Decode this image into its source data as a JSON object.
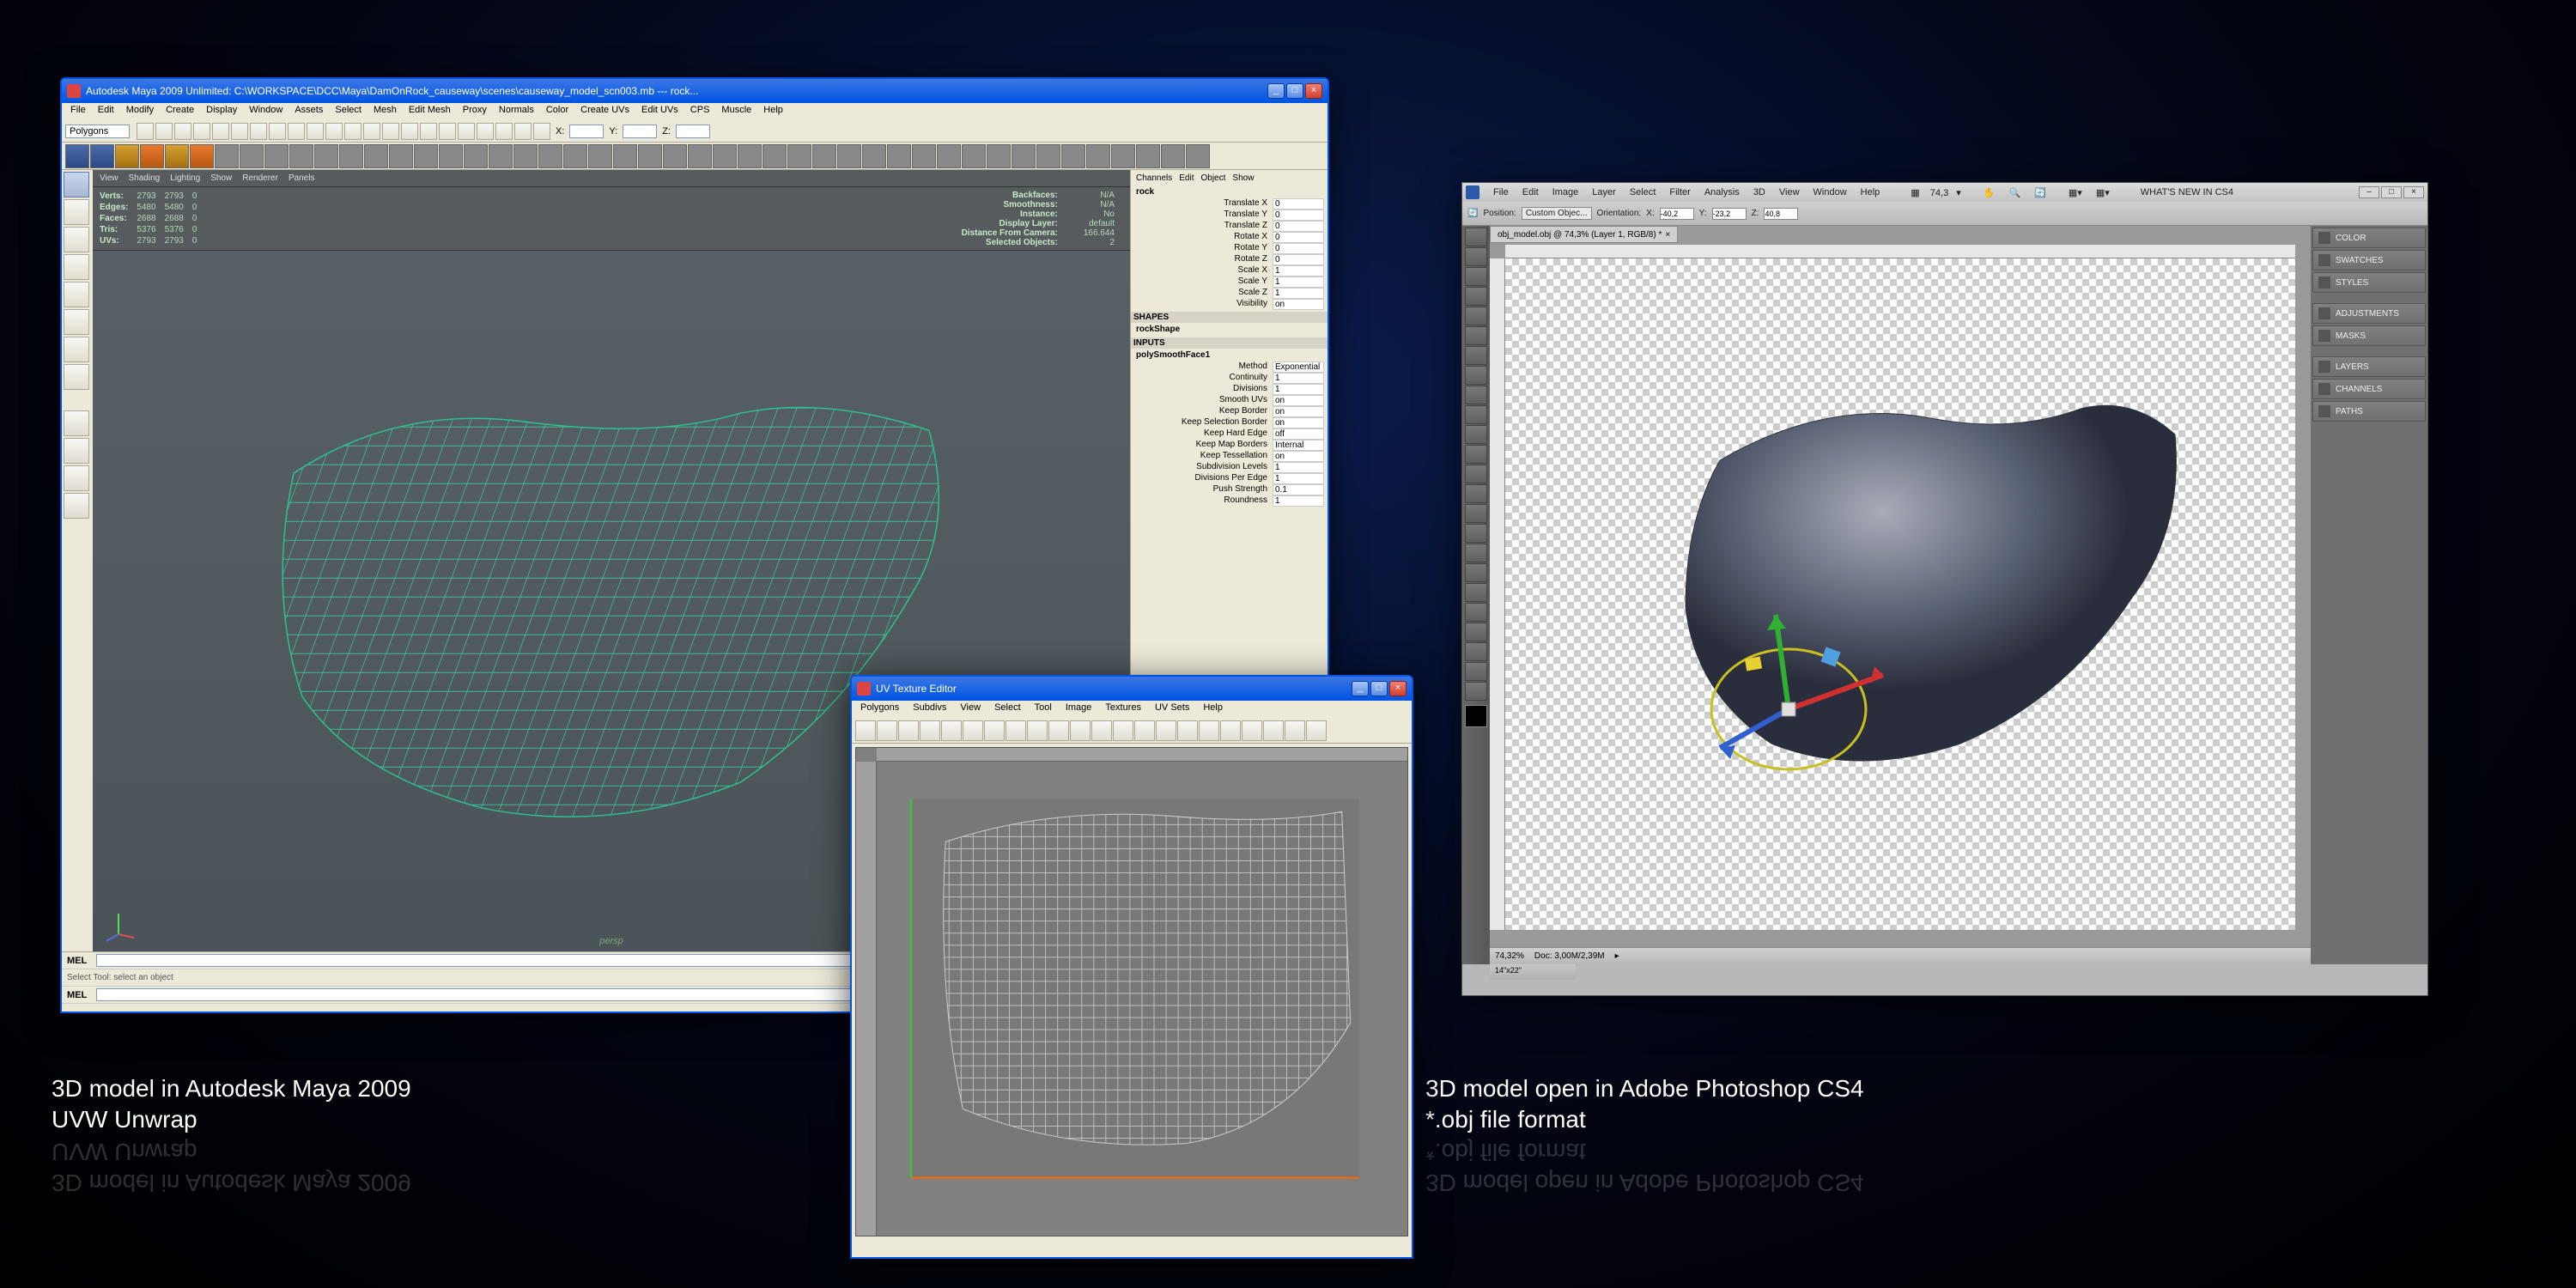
{
  "captions": {
    "left_l1": "3D model in Autodesk Maya 2009",
    "left_l2": "UVW Unwrap",
    "right_l1": "3D model open in Adobe Photoshop CS4",
    "right_l2": "*.obj file format"
  },
  "maya": {
    "title": "Autodesk Maya 2009 Unlimited: C:\\WORKSPACE\\DCC\\Maya\\DamOnRock_causeway\\scenes\\causeway_model_scn003.mb   ---   rock...",
    "menus": [
      "File",
      "Edit",
      "Modify",
      "Create",
      "Display",
      "Window",
      "Assets",
      "Select",
      "Mesh",
      "Edit Mesh",
      "Proxy",
      "Normals",
      "Color",
      "Create UVs",
      "Edit UVs",
      "CPS",
      "Muscle",
      "Help"
    ],
    "workspace_mode": "Polygons",
    "shelf_tabs_label": "",
    "opt_x": "X:",
    "opt_y": "Y:",
    "opt_z": "Z:",
    "vp_menu": [
      "View",
      "Shading",
      "Lighting",
      "Show",
      "Renderer",
      "Panels"
    ],
    "stats": {
      "verts_l": "Verts:",
      "verts_a": "2793",
      "verts_b": "2793",
      "verts_c": "0",
      "edges_l": "Edges:",
      "edges_a": "5480",
      "edges_b": "5480",
      "edges_c": "0",
      "faces_l": "Faces:",
      "faces_a": "2688",
      "faces_b": "2688",
      "faces_c": "0",
      "tris_l": "Tris:",
      "tris_a": "5376",
      "tris_b": "5376",
      "tris_c": "0",
      "uvs_l": "UVs:",
      "uvs_a": "2793",
      "uvs_b": "2793",
      "uvs_c": "0",
      "backfaces_l": "Backfaces:",
      "backfaces_v": "N/A",
      "smooth_l": "Smoothness:",
      "smooth_v": "N/A",
      "inst_l": "Instance:",
      "inst_v": "No",
      "disp_l": "Display Layer:",
      "disp_v": "default",
      "dist_l": "Distance From Camera:",
      "dist_v": "166.644",
      "sel_l": "Selected Objects:",
      "sel_v": "2"
    },
    "vp_label": "persp",
    "mel_label": "MEL",
    "mel2_label": "MEL",
    "hint": "Select Tool: select an object",
    "cb": {
      "menu": [
        "Channels",
        "Edit",
        "Object",
        "Show"
      ],
      "object": "rock",
      "rows": [
        {
          "k": "Translate X",
          "v": "0"
        },
        {
          "k": "Translate Y",
          "v": "0"
        },
        {
          "k": "Translate Z",
          "v": "0"
        },
        {
          "k": "Rotate X",
          "v": "0"
        },
        {
          "k": "Rotate Y",
          "v": "0"
        },
        {
          "k": "Rotate Z",
          "v": "0"
        },
        {
          "k": "Scale X",
          "v": "1"
        },
        {
          "k": "Scale Y",
          "v": "1"
        },
        {
          "k": "Scale Z",
          "v": "1"
        },
        {
          "k": "Visibility",
          "v": "on"
        }
      ],
      "shapes_hdr": "SHAPES",
      "shape": "rockShape",
      "inputs_hdr": "INPUTS",
      "input": "polySmoothFace1",
      "inp_rows": [
        {
          "k": "Method",
          "v": "Exponential"
        },
        {
          "k": "Continuity",
          "v": "1"
        },
        {
          "k": "Divisions",
          "v": "1"
        },
        {
          "k": "Smooth UVs",
          "v": "on"
        },
        {
          "k": "Keep Border",
          "v": "on"
        },
        {
          "k": "Keep Selection Border",
          "v": "on"
        },
        {
          "k": "Keep Hard Edge",
          "v": "off"
        },
        {
          "k": "Keep Map Borders",
          "v": "Internal"
        },
        {
          "k": "Keep Tessellation",
          "v": "on"
        },
        {
          "k": "Subdivision Levels",
          "v": "1"
        },
        {
          "k": "Divisions Per Edge",
          "v": "1"
        },
        {
          "k": "Push Strength",
          "v": "0.1"
        },
        {
          "k": "Roundness",
          "v": "1"
        }
      ]
    }
  },
  "uved": {
    "title": "UV Texture Editor",
    "menus": [
      "Polygons",
      "Subdivs",
      "View",
      "Select",
      "Tool",
      "Image",
      "Textures",
      "UV Sets",
      "Help"
    ]
  },
  "ps": {
    "menus": [
      "File",
      "Edit",
      "Image",
      "Layer",
      "Select",
      "Filter",
      "Analysis",
      "3D",
      "View",
      "Window",
      "Help"
    ],
    "zoom_small": "74,3",
    "opt_position": "Position:",
    "opt_custom": "Custom Objec...",
    "opt_orientation": "Orientation:",
    "opt_x": "X:",
    "opt_xv": "-40,2",
    "opt_y": "Y:",
    "opt_yv": "-23,2",
    "opt_z": "Z:",
    "opt_zv": "40,8",
    "whatsnew": "WHAT'S NEW IN CS4",
    "tab": "obj_model.obj @ 74,3% (Layer 1, RGB/8) *",
    "status_zoom": "74,32%",
    "status_doc": "Doc: 3,00M/2,39M",
    "status_zoom2": "14\"x22\"",
    "panels": [
      "COLOR",
      "SWATCHES",
      "STYLES",
      "ADJUSTMENTS",
      "MASKS",
      "LAYERS",
      "CHANNELS",
      "PATHS"
    ]
  }
}
